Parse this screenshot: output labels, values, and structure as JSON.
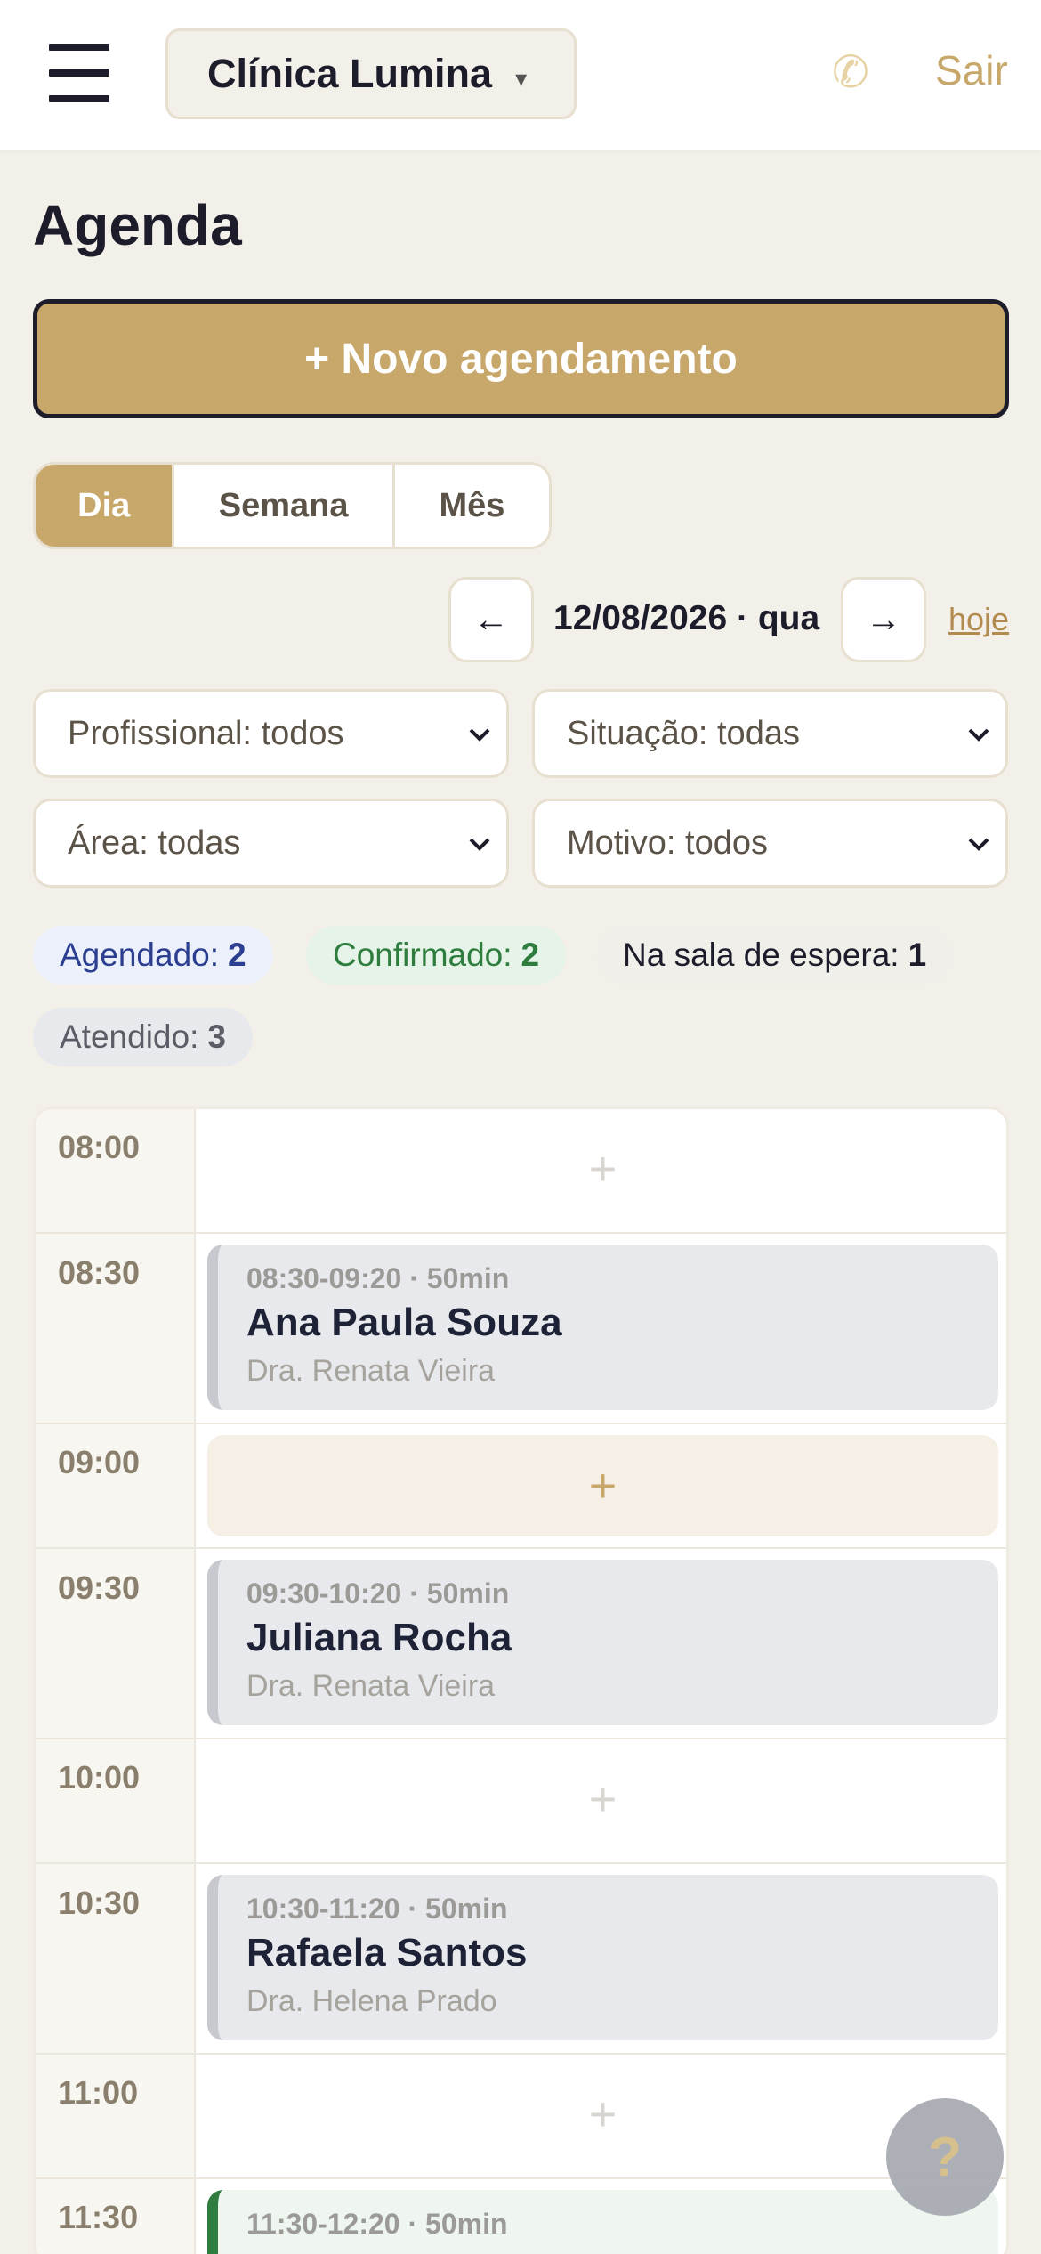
{
  "header": {
    "clinic_name": "Clínica Lumina",
    "caret": "▾",
    "phone_glyph": "✆",
    "logout_label": "Sair"
  },
  "page": {
    "title": "Agenda",
    "new_button_label": "+ Novo agendamento"
  },
  "view_tabs": [
    {
      "label": "Dia",
      "active": true
    },
    {
      "label": "Semana",
      "active": false
    },
    {
      "label": "Mês",
      "active": false
    }
  ],
  "date_nav": {
    "prev": "←",
    "date": "12/08/2026 · qua",
    "next": "→",
    "today": "hoje"
  },
  "filters": {
    "professional": "Profissional: todos",
    "status": "Situação: todas",
    "area": "Área: todas",
    "reason": "Motivo: todos"
  },
  "status_counts": [
    {
      "label": "Agendado:",
      "count": "2"
    },
    {
      "label": "Confirmado:",
      "count": "2"
    },
    {
      "label": "Na sala de espera:",
      "count": "1"
    },
    {
      "label": "Atendido:",
      "count": "3"
    }
  ],
  "schedule": {
    "times": [
      "08:00",
      "08:30",
      "09:00",
      "09:30",
      "10:00",
      "10:30",
      "11:00",
      "11:30"
    ],
    "plus": "+",
    "appointments": [
      {
        "time": "08:30-09:20 · 50min",
        "patient": "Ana Paula Souza",
        "doctor": "Dra. Renata Vieira"
      },
      {
        "time": "09:30-10:20 · 50min",
        "patient": "Juliana Rocha",
        "doctor": "Dra. Renata Vieira"
      },
      {
        "time": "10:30-11:20 · 50min",
        "patient": "Rafaela Santos",
        "doctor": "Dra. Helena Prado"
      },
      {
        "time": "11:30-12:20 · 50min",
        "patient": "",
        "doctor": ""
      }
    ]
  },
  "help": {
    "label": "?"
  },
  "colors": {
    "accent": "#c8a86a",
    "dark": "#1d1c2b",
    "background": "#f3efe9",
    "confirmed": "#2f7d3e",
    "scheduled": "#2c3e8f"
  }
}
